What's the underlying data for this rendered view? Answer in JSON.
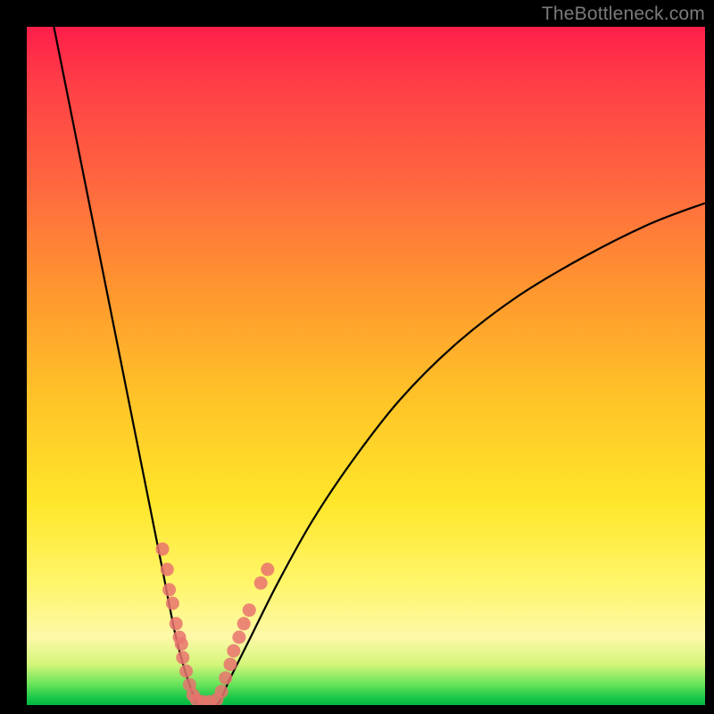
{
  "watermark": "TheBottleneck.com",
  "chart_data": {
    "type": "line",
    "title": "",
    "xlabel": "",
    "ylabel": "",
    "xlim": [
      0,
      100
    ],
    "ylim": [
      0,
      100
    ],
    "grid": false,
    "series": [
      {
        "name": "bottleneck-curve-left",
        "x": [
          4,
          6,
          8,
          10,
          12,
          14,
          16,
          18,
          20,
          22,
          24,
          25.5
        ],
        "values": [
          100,
          90,
          80,
          70,
          60,
          50,
          40,
          30,
          20,
          10,
          3,
          0
        ]
      },
      {
        "name": "bottleneck-curve-right",
        "x": [
          28,
          30,
          33,
          37,
          42,
          48,
          55,
          63,
          72,
          82,
          92,
          100
        ],
        "values": [
          0,
          4,
          10,
          18,
          27,
          36,
          45,
          53,
          60,
          66,
          71,
          74
        ]
      }
    ],
    "scatter": {
      "name": "sample-points",
      "points": [
        {
          "x": 20.0,
          "y": 23
        },
        {
          "x": 20.7,
          "y": 20
        },
        {
          "x": 21.0,
          "y": 17
        },
        {
          "x": 21.5,
          "y": 15
        },
        {
          "x": 22.0,
          "y": 12
        },
        {
          "x": 22.5,
          "y": 10
        },
        {
          "x": 22.8,
          "y": 9
        },
        {
          "x": 23.0,
          "y": 7
        },
        {
          "x": 23.5,
          "y": 5
        },
        {
          "x": 24.0,
          "y": 3
        },
        {
          "x": 24.5,
          "y": 1.5
        },
        {
          "x": 25.0,
          "y": 0.8
        },
        {
          "x": 26.0,
          "y": 0.5
        },
        {
          "x": 27.0,
          "y": 0.5
        },
        {
          "x": 28.0,
          "y": 0.8
        },
        {
          "x": 28.7,
          "y": 2
        },
        {
          "x": 29.3,
          "y": 4
        },
        {
          "x": 30.0,
          "y": 6
        },
        {
          "x": 30.5,
          "y": 8
        },
        {
          "x": 31.3,
          "y": 10
        },
        {
          "x": 32.0,
          "y": 12
        },
        {
          "x": 32.8,
          "y": 14
        },
        {
          "x": 34.5,
          "y": 18
        },
        {
          "x": 35.5,
          "y": 20
        }
      ]
    },
    "colors": {
      "curve": "#000000",
      "dots": "#e9736f",
      "gradient_top": "#ff1e4a",
      "gradient_bottom": "#00b840"
    }
  }
}
